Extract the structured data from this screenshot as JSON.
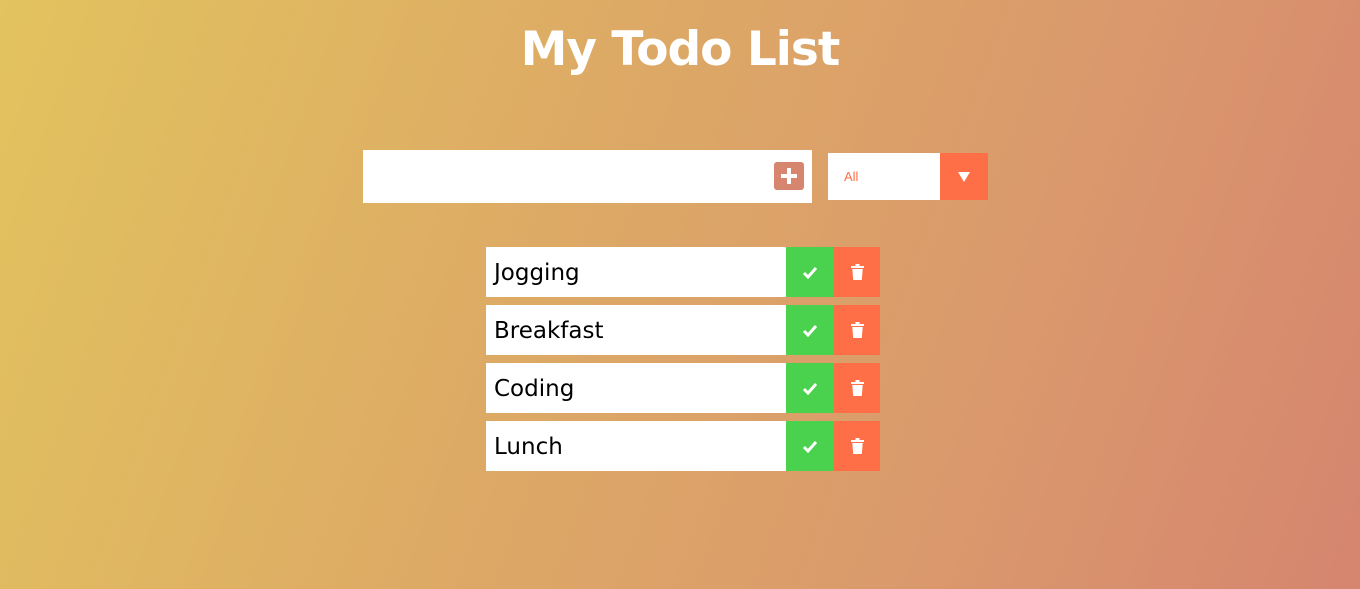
{
  "header": {
    "title": "My Todo List"
  },
  "form": {
    "input_value": "",
    "input_placeholder": "",
    "add_icon": "plus-square-icon",
    "filter_selected": "All",
    "filter_icon": "caret-down-icon"
  },
  "todos": [
    {
      "text": "Jogging",
      "complete_icon": "check-icon",
      "delete_icon": "trash-icon"
    },
    {
      "text": "Breakfast",
      "complete_icon": "check-icon",
      "delete_icon": "trash-icon"
    },
    {
      "text": "Coding",
      "complete_icon": "check-icon",
      "delete_icon": "trash-icon"
    },
    {
      "text": "Lunch",
      "complete_icon": "check-icon",
      "delete_icon": "trash-icon"
    }
  ],
  "colors": {
    "complete": "#4ad14d",
    "delete": "#ff6f47",
    "add_button": "#d6856f",
    "title": "#ffffff"
  }
}
